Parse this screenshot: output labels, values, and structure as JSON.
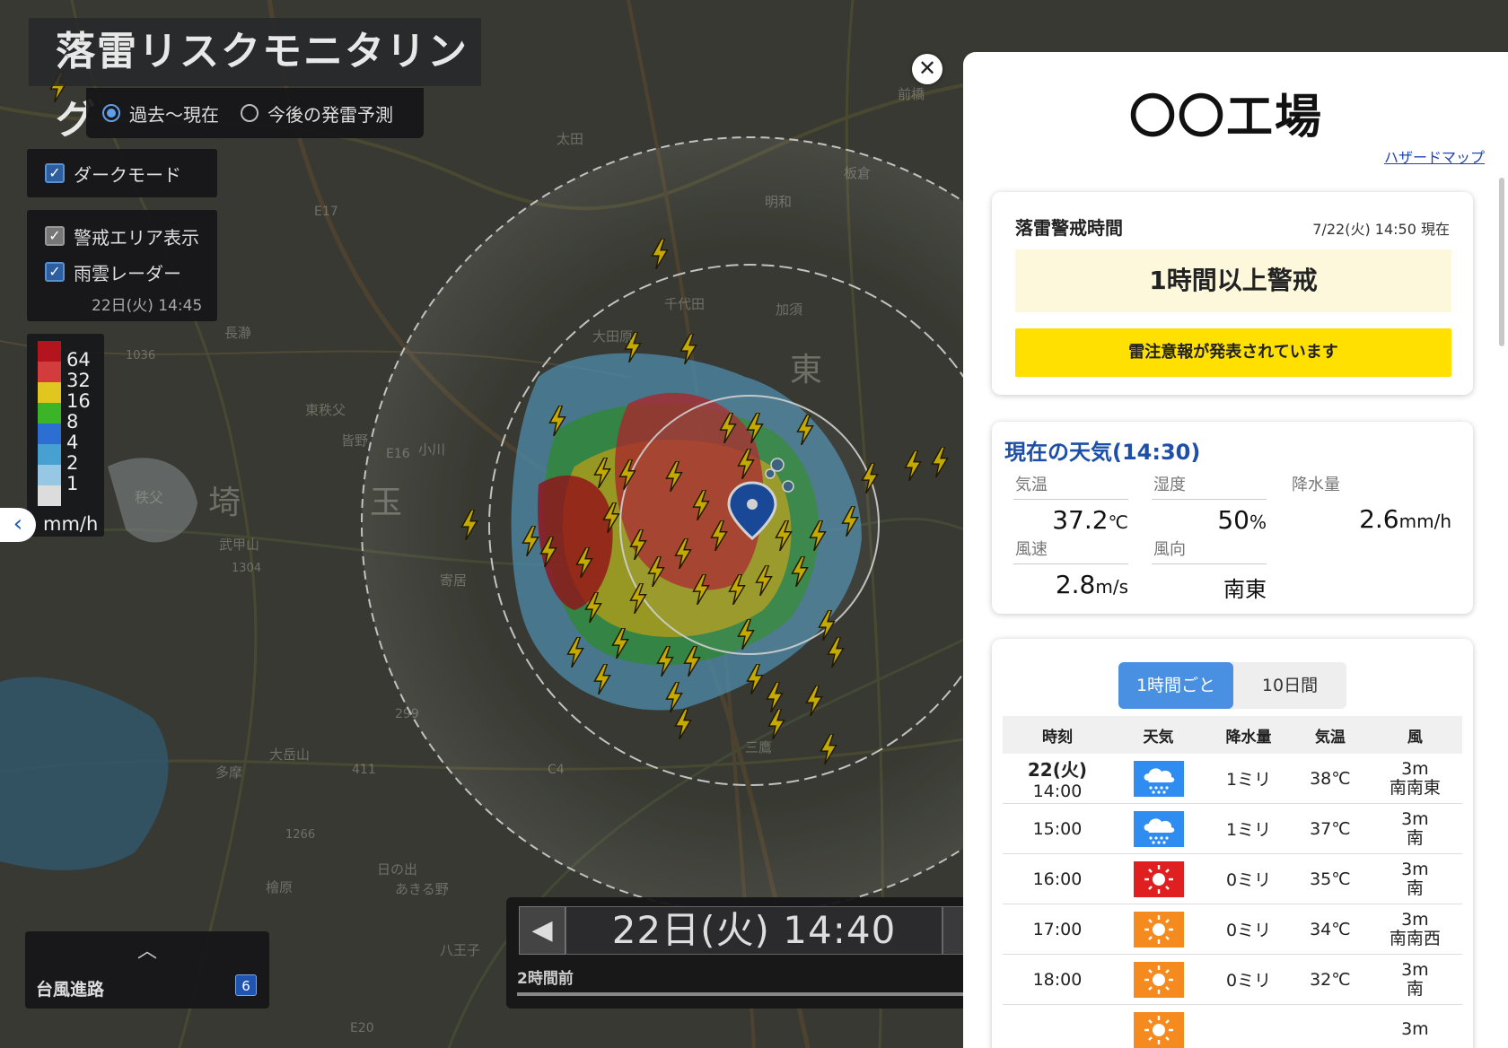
{
  "app_title": "落雷リスクモニタリング",
  "mode": {
    "options": [
      {
        "label": "過去〜現在",
        "selected": true
      },
      {
        "label": "今後の発雷予測",
        "selected": false
      }
    ]
  },
  "dark_mode": {
    "label": "ダークモード",
    "checked": true
  },
  "layers": {
    "warning_area": {
      "label": "警戒エリア表示",
      "checked": false
    },
    "radar": {
      "label": "雨雲レーダー",
      "checked": true,
      "timestamp": "22日(火) 14:45"
    }
  },
  "legend": {
    "unit": "mm/h",
    "levels": [
      {
        "label": "64",
        "color": "#b4141e"
      },
      {
        "label": "32",
        "color": "#d23c3c"
      },
      {
        "label": "16",
        "color": "#e0c61e"
      },
      {
        "label": "8",
        "color": "#3cb428"
      },
      {
        "label": "4",
        "color": "#2d6ed2"
      },
      {
        "label": "2",
        "color": "#46a0d2"
      },
      {
        "label": "1",
        "color": "#96c8e6"
      },
      {
        "label": "",
        "color": "#dcdcdc"
      }
    ]
  },
  "map_labels": [
    "埼",
    "玉",
    "東",
    "秩父",
    "武甲山",
    "大岳山",
    "多摩",
    "三鷹",
    "千代田",
    "明和",
    "板倉",
    "加須",
    "長瀞",
    "小川",
    "東秩父",
    "寄居",
    "皆野",
    "日の出",
    "あきる野",
    "檜原",
    "八王子",
    "大田原",
    "太田",
    "前橋",
    "E17",
    "E16",
    "E20",
    "C4",
    "411",
    "299",
    "1036",
    "1304",
    "1266"
  ],
  "collapse_icon": "chevron-left-icon",
  "typhoon": {
    "label": "台風進路",
    "count": "6",
    "toggle_icon": "chevron-up-icon"
  },
  "timebar": {
    "time": "22日(火) 14:40",
    "elapsed": "2時間前",
    "prev_icon": "triangle-left-icon"
  },
  "close_icon": "close-icon",
  "panel": {
    "site_name": "〇〇工場",
    "hazard_link": "ハザードマップ",
    "warning": {
      "title": "落雷警戒時間",
      "timestamp": "7/22(火) 14:50 現在",
      "level": "1時間以上警戒",
      "notice": "雷注意報が発表されています"
    },
    "current": {
      "title": "現在の天気(14:30)",
      "temperature": {
        "label": "気温",
        "value": "37.2",
        "unit": "℃"
      },
      "humidity": {
        "label": "湿度",
        "value": "50",
        "unit": "%"
      },
      "precipitation": {
        "label": "降水量",
        "value": "2.6",
        "unit": "mm/h"
      },
      "wind_speed": {
        "label": "風速",
        "value": "2.8",
        "unit": "m/s"
      },
      "wind_direction": {
        "label": "風向",
        "value": "南東"
      }
    },
    "forecast": {
      "tabs": [
        {
          "label": "1時間ごと",
          "active": true
        },
        {
          "label": "10日間",
          "active": false
        }
      ],
      "columns": [
        "時刻",
        "天気",
        "降水量",
        "気温",
        "風"
      ],
      "rows": [
        {
          "date": "22(火)",
          "time": "14:00",
          "weather_icon": "rain-icon",
          "precip": "1ミリ",
          "temp": "38℃",
          "wind_speed": "3m",
          "wind_dir": "南南東"
        },
        {
          "date": "",
          "time": "15:00",
          "weather_icon": "rain-icon",
          "precip": "1ミリ",
          "temp": "37℃",
          "wind_speed": "3m",
          "wind_dir": "南"
        },
        {
          "date": "",
          "time": "16:00",
          "weather_icon": "hot-sun-icon",
          "precip": "0ミリ",
          "temp": "35℃",
          "wind_speed": "3m",
          "wind_dir": "南"
        },
        {
          "date": "",
          "time": "17:00",
          "weather_icon": "sun-icon",
          "precip": "0ミリ",
          "temp": "34℃",
          "wind_speed": "3m",
          "wind_dir": "南南西"
        },
        {
          "date": "",
          "time": "18:00",
          "weather_icon": "sun-icon",
          "precip": "0ミリ",
          "temp": "32℃",
          "wind_speed": "3m",
          "wind_dir": "南"
        },
        {
          "date": "",
          "time": "",
          "weather_icon": "sun-icon",
          "precip": "",
          "temp": "",
          "wind_speed": "3m",
          "wind_dir": ""
        }
      ]
    }
  }
}
